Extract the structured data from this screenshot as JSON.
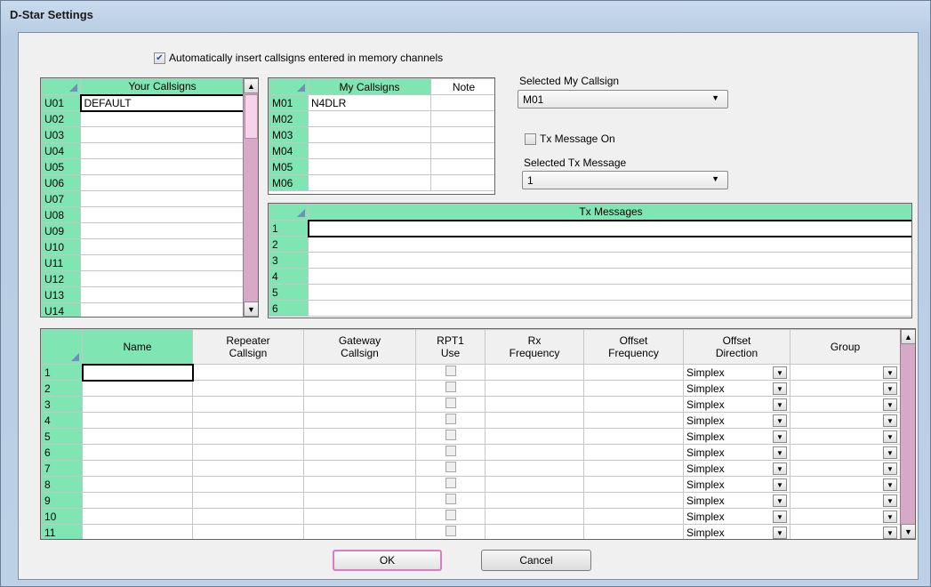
{
  "window": {
    "title": "D-Star Settings"
  },
  "auto_insert": {
    "checked": true,
    "label": "Automatically insert callsigns entered in memory channels"
  },
  "your_callsigns": {
    "header": "Your Callsigns",
    "rows": [
      {
        "id": "U01",
        "value": "DEFAULT"
      },
      {
        "id": "U02",
        "value": ""
      },
      {
        "id": "U03",
        "value": ""
      },
      {
        "id": "U04",
        "value": ""
      },
      {
        "id": "U05",
        "value": ""
      },
      {
        "id": "U06",
        "value": ""
      },
      {
        "id": "U07",
        "value": ""
      },
      {
        "id": "U08",
        "value": ""
      },
      {
        "id": "U09",
        "value": ""
      },
      {
        "id": "U10",
        "value": ""
      },
      {
        "id": "U11",
        "value": ""
      },
      {
        "id": "U12",
        "value": ""
      },
      {
        "id": "U13",
        "value": ""
      },
      {
        "id": "U14",
        "value": ""
      }
    ]
  },
  "my_callsigns": {
    "headers": [
      "My Callsigns",
      "Note"
    ],
    "rows": [
      {
        "id": "M01",
        "value": "N4DLR",
        "note": ""
      },
      {
        "id": "M02",
        "value": "",
        "note": ""
      },
      {
        "id": "M03",
        "value": "",
        "note": ""
      },
      {
        "id": "M04",
        "value": "",
        "note": ""
      },
      {
        "id": "M05",
        "value": "",
        "note": ""
      },
      {
        "id": "M06",
        "value": "",
        "note": ""
      }
    ]
  },
  "selected_my_callsign": {
    "label": "Selected My Callsign",
    "value": "M01"
  },
  "tx_message_on": {
    "checked": false,
    "label": "Tx Message On"
  },
  "selected_tx_message": {
    "label": "Selected Tx Message",
    "value": "1"
  },
  "tx_messages": {
    "header": "Tx Messages",
    "rows": [
      {
        "id": "1",
        "value": ""
      },
      {
        "id": "2",
        "value": ""
      },
      {
        "id": "3",
        "value": ""
      },
      {
        "id": "4",
        "value": ""
      },
      {
        "id": "5",
        "value": ""
      },
      {
        "id": "6",
        "value": ""
      }
    ]
  },
  "channels": {
    "headers": [
      {
        "key": "name",
        "label": "Name"
      },
      {
        "key": "repeater",
        "label": "Repeater\nCallsign"
      },
      {
        "key": "gateway",
        "label": "Gateway\nCallsign"
      },
      {
        "key": "rpt1",
        "label": "RPT1\nUse"
      },
      {
        "key": "rx",
        "label": "Rx\nFrequency"
      },
      {
        "key": "offset_freq",
        "label": "Offset\nFrequency"
      },
      {
        "key": "offset_dir",
        "label": "Offset\nDirection"
      },
      {
        "key": "group",
        "label": "Group"
      }
    ],
    "rows": [
      {
        "id": "1",
        "offset_dir": "Simplex"
      },
      {
        "id": "2",
        "offset_dir": "Simplex"
      },
      {
        "id": "3",
        "offset_dir": "Simplex"
      },
      {
        "id": "4",
        "offset_dir": "Simplex"
      },
      {
        "id": "5",
        "offset_dir": "Simplex"
      },
      {
        "id": "6",
        "offset_dir": "Simplex"
      },
      {
        "id": "7",
        "offset_dir": "Simplex"
      },
      {
        "id": "8",
        "offset_dir": "Simplex"
      },
      {
        "id": "9",
        "offset_dir": "Simplex"
      },
      {
        "id": "10",
        "offset_dir": "Simplex"
      },
      {
        "id": "11",
        "offset_dir": "Simplex"
      }
    ]
  },
  "buttons": {
    "ok": "OK",
    "cancel": "Cancel"
  },
  "colors": {
    "header_green": "#7fe6b3",
    "scrollbar_pink": "#d8a8c8",
    "default_button_border": "#e07ac0"
  }
}
